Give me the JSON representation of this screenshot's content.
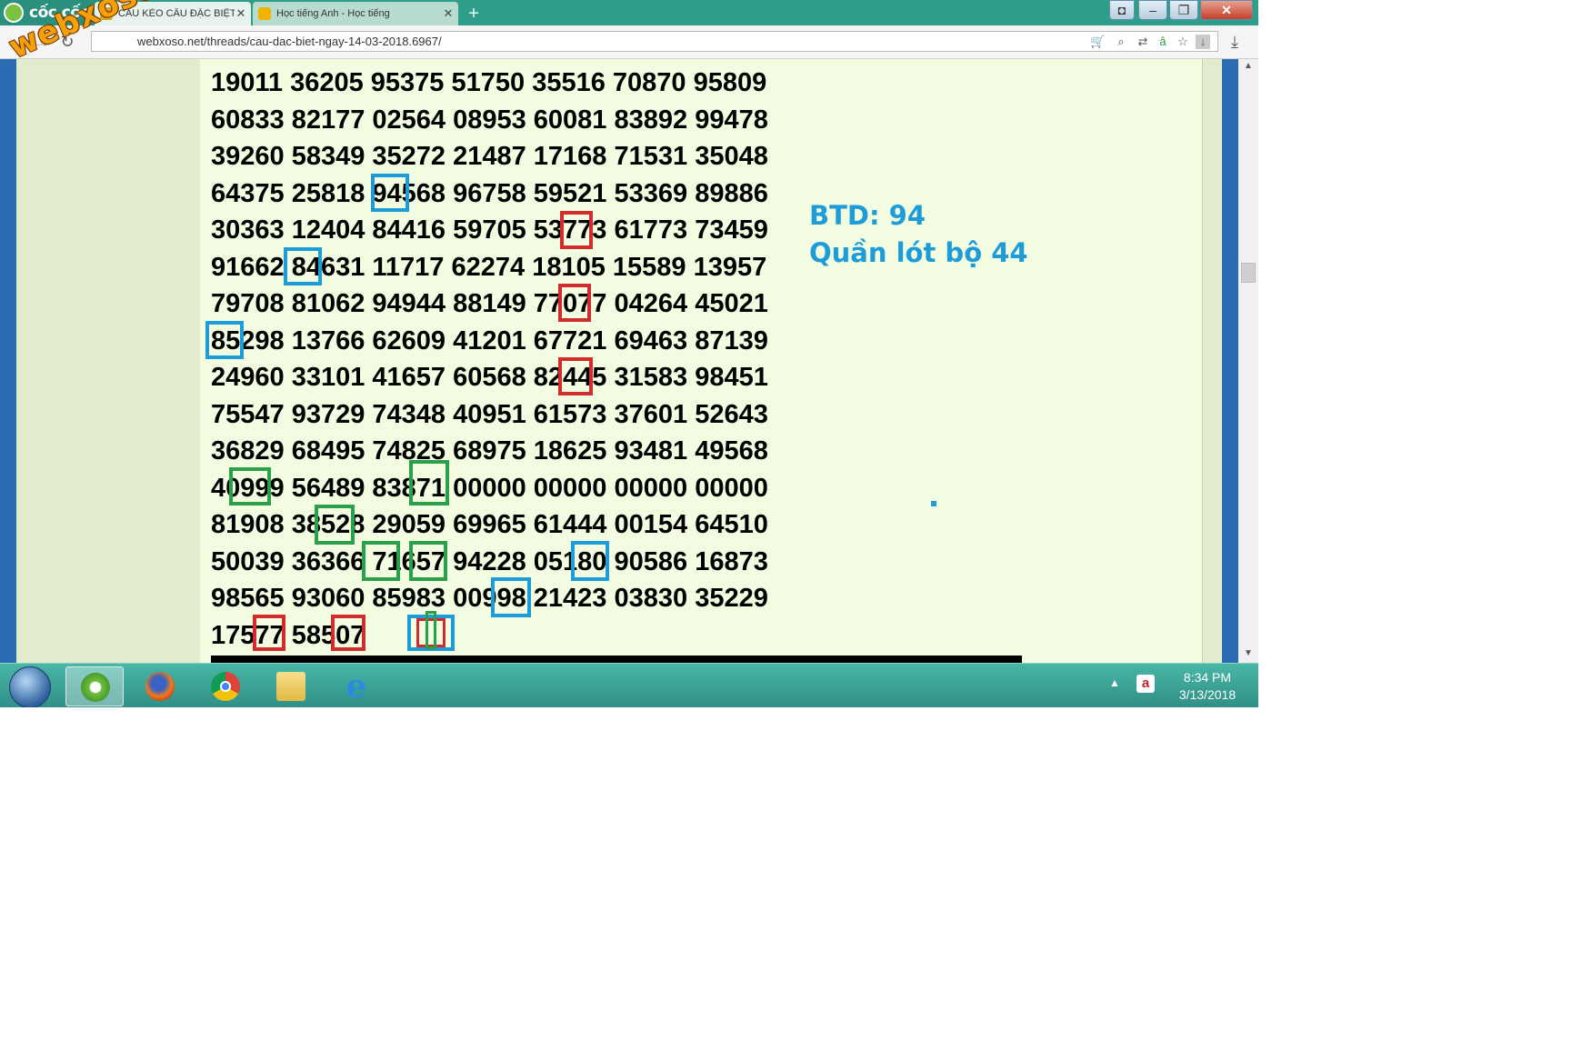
{
  "browser": {
    "brand": "cốc cốc",
    "tabs": [
      {
        "label": "CẦU KÈO CẦU ĐẶC BIỆT",
        "active": true
      },
      {
        "label": "Học tiếng Anh - Học tiếng",
        "active": false
      }
    ],
    "new_tab": "+",
    "address": "webxoso.net/threads/cau-dac-biet-ngay-14-03-2018.6967/"
  },
  "watermark": "webxoso.net",
  "page": {
    "number_rows": [
      "19011 36205 95375 51750 35516 70870 95809",
      "60833 82177 02564 08953 60081 83892 99478",
      "39260 58349 35272 21487 17168 71531 35048",
      "64375 25818 94568 96758 59521 53369 89886",
      "30363 12404 84416 59705 53773 61773 73459",
      "91662 84631 11717 62274 18105 15589 13957",
      "79708 81062 94944 88149 77077 04264 45021",
      "85298 13766 62609 41201 67721 69463 87139",
      "24960 33101 41657 60568 82445 31583 98451",
      "75547 93729 74348 40951 61573 37601 52643",
      "36829 68495 74825 68975 18625 93481 49568",
      "40999 56489 83871 00000 00000 00000 00000",
      "81908 38528 29059 69965 61444 00154 64510",
      "50039 36366 71657 94228 05180 90586 16873",
      "98565 93060 85983 00998 21423 03830 35229",
      "17577 58507"
    ],
    "note_line1": "BTD: 94",
    "note_line2": "Quần lót bộ 44",
    "colors": {
      "blue_mark": "#1e9cd8",
      "red_mark": "#d22b2b",
      "green_mark": "#2aa04a",
      "panel_bg": "#f2fce0"
    }
  },
  "taskbar": {
    "apps": [
      "coccoc-icon",
      "firefox-icon",
      "chrome-icon",
      "explorer-folder-icon",
      "internet-explorer-icon"
    ],
    "time": "8:34 PM",
    "date": "3/13/2018"
  }
}
